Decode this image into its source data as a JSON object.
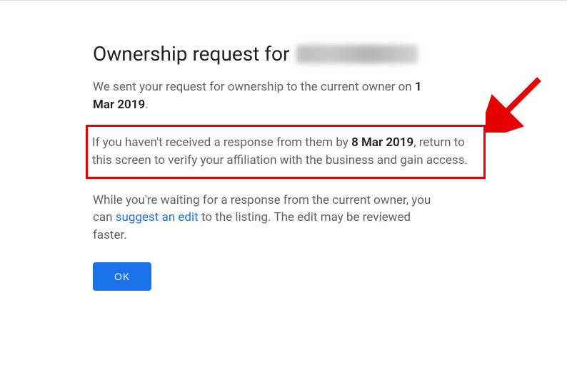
{
  "heading": {
    "prefix": "Ownership request for"
  },
  "paragraphs": {
    "sent": {
      "text_before": "We sent your request for ownership to the current owner on ",
      "date": "1 Mar 2019",
      "text_after": "."
    },
    "deadline": {
      "text_before": "If you haven't received a response from them by ",
      "date": "8 Mar 2019",
      "text_after": ", return to this screen to verify your affiliation with the business and gain access."
    },
    "waiting": {
      "text_before": "While you're waiting for a response from the current owner, you can ",
      "link_text": "suggest an edit",
      "text_after": " to the listing. The edit may be reviewed faster."
    }
  },
  "button": {
    "ok": "OK"
  }
}
